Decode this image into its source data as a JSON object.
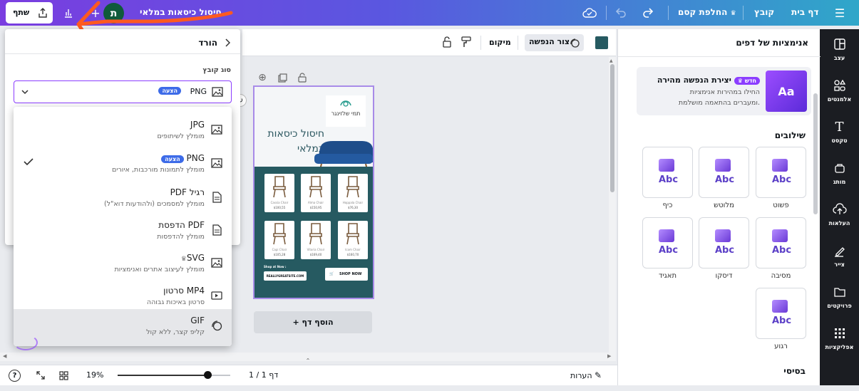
{
  "colors": {
    "accent": "#8b3dff",
    "badge": "#3d6be8",
    "rail": "#1b1d22",
    "poster_dark": "#265a61"
  },
  "topbar": {
    "menu_icon": "menu-icon",
    "home": "דף בית",
    "file": "קובץ",
    "resize": "החלפת קסם",
    "title": "חיסול כיסאות במלאי",
    "avatar": "ת",
    "share": "שתף"
  },
  "rail": [
    {
      "label": "עצב",
      "icon": "layout-icon"
    },
    {
      "label": "אלמנטים",
      "icon": "shapes-icon"
    },
    {
      "label": "טקסט",
      "icon": "text-icon"
    },
    {
      "label": "מותג",
      "icon": "brand-icon"
    },
    {
      "label": "העלאות",
      "icon": "upload-icon"
    },
    {
      "label": "צייר",
      "icon": "draw-icon"
    },
    {
      "label": "פרויקטים",
      "icon": "folder-icon"
    },
    {
      "label": "אפליקציות",
      "icon": "apps-icon"
    }
  ],
  "panel": {
    "title": "אנימציות של דפים",
    "promo": {
      "title": "יצירת הנפשה מהירה",
      "badge": "חדש",
      "desc": "החילו במהירות אנימציות ומעברים בהתאמה מושלמת."
    },
    "section_combos": "שילובים",
    "cards": [
      "פשוט",
      "מלוטש",
      "כיף",
      "מסיבה",
      "דיסקו",
      "תאגיד",
      "רגוע"
    ],
    "card_text": "Abc",
    "section_basic": "בסיסי"
  },
  "toolbar2": {
    "animate": "צור הנפשה",
    "position": "מיקום"
  },
  "download": {
    "back_title": "הורד",
    "file_type_label": "סוג קובץ",
    "selected": "PNG",
    "suggested": "הצעה",
    "options": [
      {
        "name": "JPG",
        "desc": "מומלץ לשיתופים",
        "icon": "image-icon"
      },
      {
        "name": "PNG",
        "desc": "מומלץ לתמונות מורכבות, איורים",
        "icon": "image-icon",
        "badge": "הצעה",
        "checked": true
      },
      {
        "name": "PDF רגיל",
        "desc": "מומלץ למסמכים (ולהודעות דוא\"ל)",
        "icon": "document-icon"
      },
      {
        "name": "הדפסת PDF",
        "desc": "מומלץ להדפסות",
        "icon": "document-icon"
      },
      {
        "name": "SVG",
        "desc": "מומלץ לעיצוב אתרים ואנימציות",
        "icon": "image-icon",
        "crown": true
      },
      {
        "name": "סרטון MP4",
        "desc": "סרטון באיכות גבוהה",
        "icon": "video-icon"
      },
      {
        "name": "GIF",
        "desc": "קליפ קצר, ללא קול",
        "icon": "gif-icon",
        "hover": true
      }
    ]
  },
  "poster": {
    "brand_name": "תמי שלזינגר",
    "headline": "חיסול כיסאות במלאי",
    "products": [
      {
        "name": "Cassia Chair",
        "price": "$100,55"
      },
      {
        "name": "Alma Chair",
        "price": "$150,95"
      },
      {
        "name": "Hoppala Chair",
        "price": "$76,30"
      },
      {
        "name": "Capi Chair",
        "price": "$105,28"
      },
      {
        "name": "Vitoria Chair",
        "price": "$169,40"
      },
      {
        "name": "Icom Chair",
        "price": "$160,70"
      }
    ],
    "shop_label": "Shop at Now :",
    "website": "REALLYGREATSITE.COM",
    "shop_button": "SHOP NOW"
  },
  "canvas": {
    "add_page": "+ הוסף דף"
  },
  "bottom": {
    "notes": "הערות",
    "page": "דף 1 / 1",
    "zoom": "19%",
    "zoom_fraction": 0.8
  }
}
